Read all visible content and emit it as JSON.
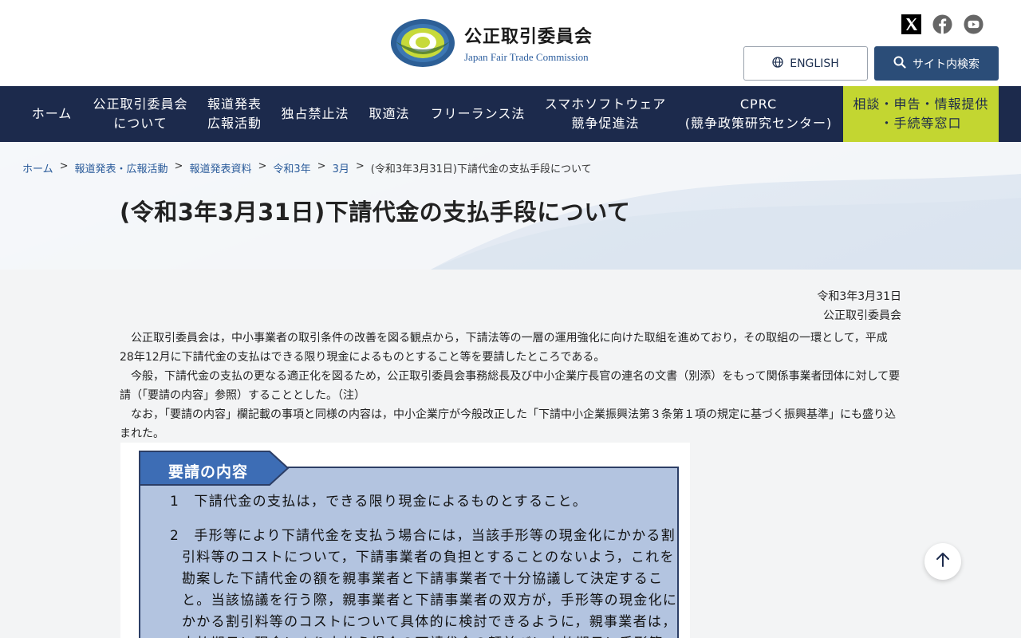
{
  "header": {
    "org_name_jp": "公正取引委員会",
    "org_name_en": "Japan Fair Trade Commission",
    "logo_ring_text": "JAPAN FAIR TRADE COMMISSION",
    "english_button": "ENGLISH",
    "search_button": "サイト内検索",
    "social_icons": [
      "x-icon",
      "facebook-icon",
      "youtube-icon"
    ]
  },
  "nav": {
    "items": [
      {
        "line1": "ホーム",
        "line2": ""
      },
      {
        "line1": "公正取引委員会",
        "line2": "について"
      },
      {
        "line1": "報道発表",
        "line2": "広報活動"
      },
      {
        "line1": "独占禁止法",
        "line2": ""
      },
      {
        "line1": "取適法",
        "line2": ""
      },
      {
        "line1": "フリーランス法",
        "line2": ""
      },
      {
        "line1": "スマホソフトウェア",
        "line2": "競争促進法"
      },
      {
        "line1": "CPRC",
        "line2": "(競争政策研究センター)"
      },
      {
        "line1": "相談・申告・情報提供",
        "line2": "・手続等窓口"
      }
    ]
  },
  "breadcrumb": {
    "items": [
      "ホーム",
      "報道発表・広報活動",
      "報道発表資料",
      "令和3年",
      "3月"
    ],
    "separator": ">",
    "current": "(令和3年3月31日)下請代金の支払手段について"
  },
  "page_title": "(令和3年3月31日)下請代金の支払手段について",
  "content": {
    "date": "令和3年3月31日",
    "issuer": "公正取引委員会",
    "paragraphs": [
      "公正取引委員会は，中小事業者の取引条件の改善を図る観点から，下請法等の一層の運用強化に向けた取組を進めており，その取組の一環として，平成28年12月に下請代金の支払はできる限り現金によるものとすること等を要請したところである。",
      "今般，下請代金の支払の更なる適正化を図るため，公正取引委員会事務総長及び中小企業庁長官の連名の文書（別添）をもって関係事業者団体に対して要請（「要請の内容」参照）することとした。（注）",
      "なお，「要請の内容」欄記載の事項と同様の内容は，中小企業庁が今般改正した「下請中小企業振興法第３条第１項の規定に基づく振興基準」にも盛り込まれた。"
    ],
    "request_box": {
      "tab_label": "要請の内容",
      "lines": [
        "1　下請代金の支払は，できる限り現金によるものとすること。",
        "2　手形等により下請代金を支払う場合には，当該手形等の現金化にかかる割",
        "引料等のコストについて，下請事業者の負担とすることのないよう，これを",
        "勘案した下請代金の額を親事業者と下請事業者で十分協議して決定するこ",
        "と。当該協議を行う際，親事業者と下請事業者の双方が，手形等の現金化に",
        "かかる割引料等のコストについて具体的に検討できるように，親事業者は，",
        "支払期日に現金により支払う場合の下請代金の額並びに支払期日に手形等"
      ]
    }
  },
  "back_to_top": "back-to-top"
}
